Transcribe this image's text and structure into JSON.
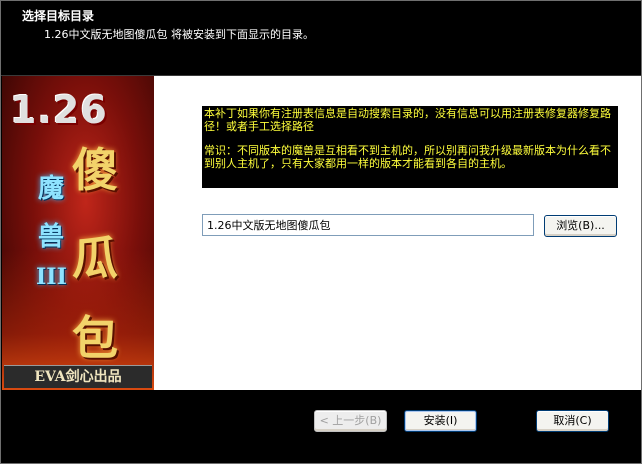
{
  "header": {
    "title": "选择目标目录",
    "subtitle": "1.26中文版无地图傻瓜包 将被安装到下面显示的目录。"
  },
  "banner": {
    "version": "1.26",
    "big_chars": [
      "傻",
      "瓜",
      "包"
    ],
    "small_chars": [
      "魔",
      "兽",
      "III"
    ],
    "maker": "EVA剑心出品"
  },
  "info": {
    "line1": "本补丁如果你有注册表信息是自动搜索目录的，没有信息可以用注册表修复器修复路径！或者手工选择路径",
    "line2": "常识：不同版本的魔兽是互相看不到主机的，所以别再问我升级最新版本为什么看不到别人主机了，只有大家都用一样的版本才能看到各自的主机。"
  },
  "path": {
    "value": "1.26中文版无地图傻瓜包"
  },
  "buttons": {
    "browse": "浏览(B)...",
    "back": "< 上一步(B)",
    "install": "安装(I)",
    "cancel": "取消(C)"
  }
}
